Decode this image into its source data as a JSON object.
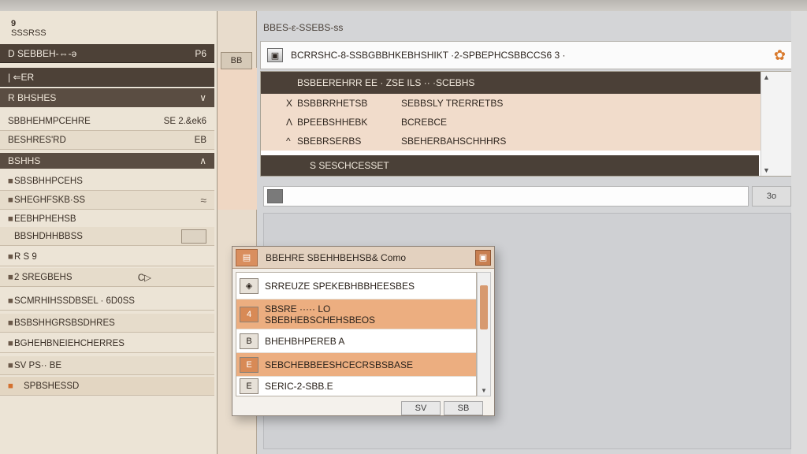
{
  "left_panel": {
    "title_line1": "9",
    "title_line2": "SSSRSS",
    "header_bar": {
      "label": "D SEBBEH-⇔-ǝ",
      "right": "P6"
    },
    "sub_bar": {
      "label": "| ⇐ER"
    },
    "section_bar": {
      "label": "R BHSHES",
      "chevron": "∨"
    },
    "rows_group1": [
      {
        "label": "SBBHEHMPCEHRE",
        "right": "SE 2.&ek6"
      },
      {
        "label": "BESHRES'RD",
        "right": "EB"
      }
    ],
    "group2_bar": {
      "label": "BSHHS",
      "chevron": "∧"
    },
    "rows_group2": [
      {
        "label": "SBSBHHPCEHS",
        "bullet": "■"
      },
      {
        "label": "SHEGHFSKB·SS",
        "bullet": "■"
      },
      {
        "label": "EEBHPHEHSB",
        "bullet": "■"
      },
      {
        "label": "BBSHDHHBBSS",
        "bullet": ""
      }
    ],
    "rows_group3": [
      {
        "label": "R S 9",
        "bullet": "■"
      },
      {
        "label": "2 SREGBEHS",
        "bullet": "■",
        "right": "C▷"
      },
      {
        "label": "SCMRHIHSSDBSEL · 6D0SS",
        "bullet": "■"
      },
      {
        "label": "BSBSHHGRSBSDHRES",
        "bullet": "■"
      },
      {
        "label": "BGHEHBNEIEHCHERRES",
        "bullet": "■"
      },
      {
        "label": "SV PS·· BE",
        "bullet": "■"
      },
      {
        "label": "SPBSHESSD",
        "bullet": "■"
      }
    ]
  },
  "middle_strip": {
    "tab_label": "BB"
  },
  "right_area": {
    "title": "BBES-ε-SSEBS-ss",
    "address": {
      "icon": "▣",
      "text": "BCRRSHC-8-SSBGBBHKEBHSHIKT ·2-SPBEPHCSBBCCS6 3 ·"
    },
    "list_header": "BSBEEREHRR EE · ZSE ILS ·· ·SCEBHS",
    "list_rows": [
      {
        "prefix": "X",
        "col1": "BSBBRRHETSB",
        "col2": "SEBBSLY TRERRETBS"
      },
      {
        "prefix": "Λ",
        "col1": "BPEEBSHHEBK",
        "col2": "BCREBCE"
      },
      {
        "prefix": "^",
        "col1": "SBEBRSERBS",
        "col2": "SBEHERBAHSCHHHRS"
      }
    ],
    "list_footer": "S SESCHCESSET",
    "search_placeholder": "",
    "search_button": "3o"
  },
  "popup": {
    "title": "BBEHRE SBEHHBEHSB& Como",
    "items": [
      {
        "icon": "◈",
        "line1": "SRREUZE SPEKEBHBBHEESBES",
        "line2": "",
        "selected": false
      },
      {
        "icon": "4",
        "line1": "SBSRE ····· LO",
        "line2": "SBEBHEBSCHEHSBEOS",
        "selected": true
      },
      {
        "icon": "B",
        "line1": "BHEHBHPEREB A",
        "line2": "",
        "selected": false
      },
      {
        "icon": "E",
        "line1": "SEBCHEBBEESHCECRSBSBASE",
        "line2": "",
        "selected": true
      },
      {
        "icon": "E",
        "line1": "SERIC-2-SBB.E",
        "line2": "",
        "selected": false
      }
    ],
    "buttons": [
      "SV",
      "SB"
    ]
  }
}
